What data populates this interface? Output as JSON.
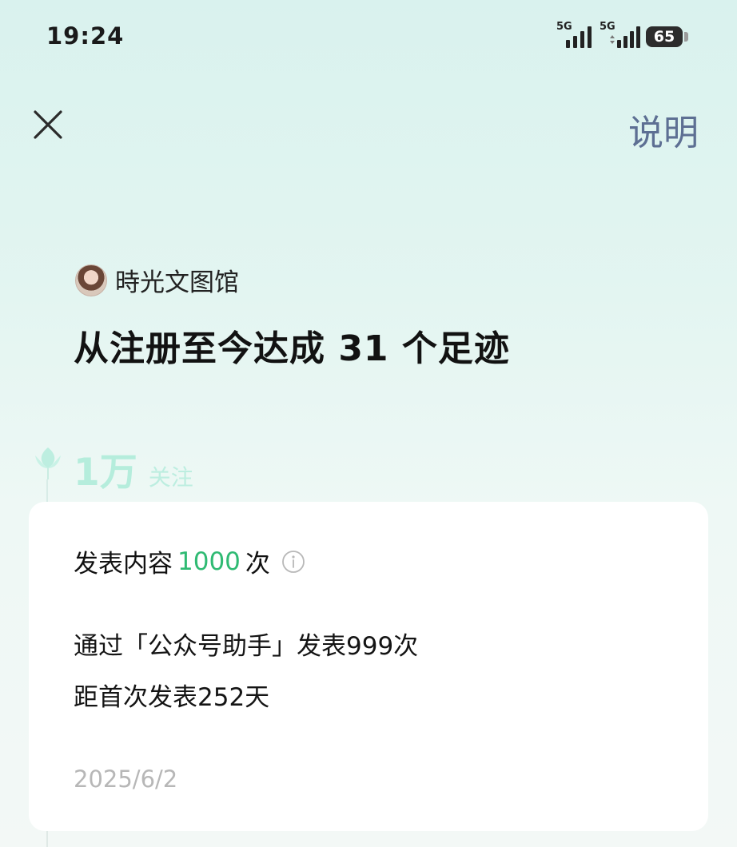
{
  "status_bar": {
    "time": "19:24",
    "network_1": "5G",
    "network_2": "5G",
    "battery": "65"
  },
  "header": {
    "explain_label": "说明"
  },
  "author": {
    "name": "時光文图馆"
  },
  "headline": "从注册至今达成 31 个足迹",
  "milestone": {
    "value": "1万",
    "label": "关注"
  },
  "card": {
    "title_prefix": "发表内容",
    "title_count": "1000",
    "title_suffix": "次",
    "line1": "通过「公众号助手」发表999次",
    "line2": "距首次发表252天",
    "date": "2025/6/2"
  },
  "colors": {
    "accent_green": "#2fba73",
    "explain_blue": "#5d6f93"
  },
  "icons": {
    "close": "close-icon",
    "info": "info-icon",
    "timeline": "leaf-icon"
  }
}
